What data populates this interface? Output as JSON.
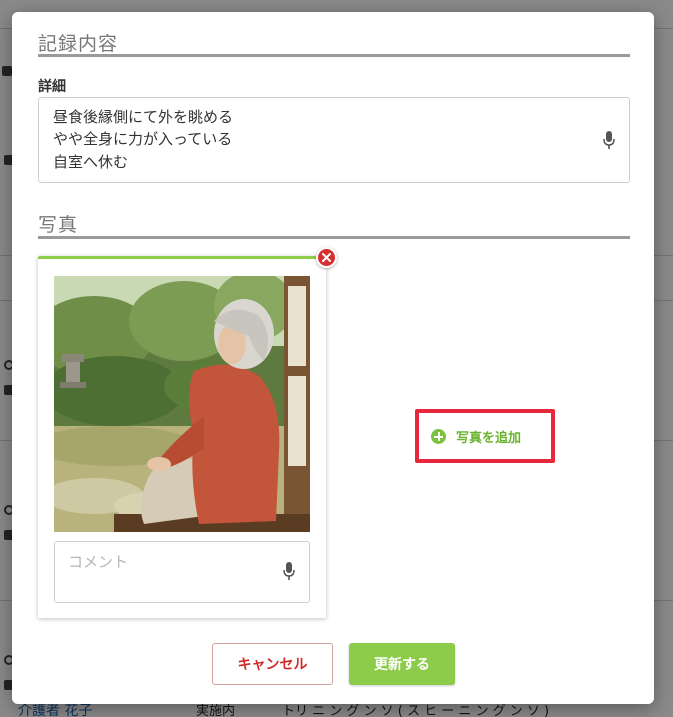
{
  "background": {
    "name": "介護者 花子",
    "row_label": "実施内",
    "row_value": "トリ ニ ン グ ン ソ ( ス ヒ ー ニ ン グ ン ソ )"
  },
  "modal": {
    "record_section_title": "記録内容",
    "detail_label": "詳細",
    "detail_lines": [
      "昼食後縁側にて外を眺める",
      "やや全身に力が入っている",
      "自室へ休む"
    ],
    "photo_section_title": "写真",
    "comment_placeholder": "コメント",
    "add_photo_label": "写真を追加",
    "cancel_label": "キャンセル",
    "update_label": "更新する"
  },
  "colors": {
    "accent_green": "#8ccc4a",
    "danger_red": "#d83030",
    "highlight_red": "#e8263c"
  },
  "icons": [
    "mic-icon",
    "close-icon",
    "plus-circle-icon"
  ]
}
